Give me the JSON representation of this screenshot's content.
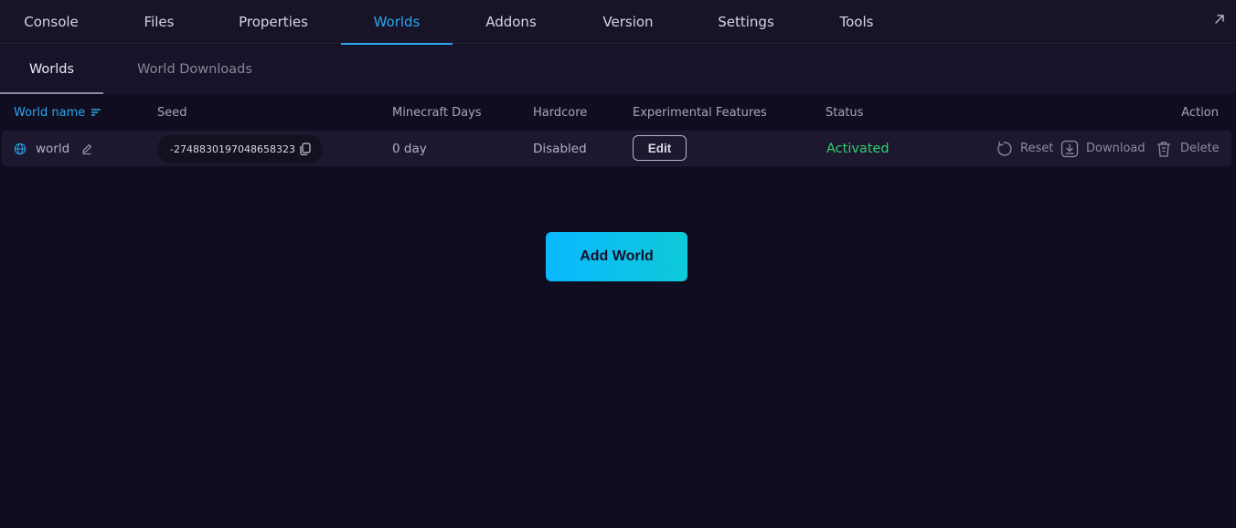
{
  "topnav": {
    "tabs": [
      {
        "label": "Console"
      },
      {
        "label": "Files"
      },
      {
        "label": "Properties"
      },
      {
        "label": "Worlds"
      },
      {
        "label": "Addons"
      },
      {
        "label": "Version"
      },
      {
        "label": "Settings"
      },
      {
        "label": "Tools"
      }
    ],
    "active_tab": "Worlds",
    "external_icon": "external-link-icon"
  },
  "subnav": {
    "tabs": [
      {
        "label": "Worlds"
      },
      {
        "label": "World Downloads"
      }
    ],
    "active_tab": "Worlds"
  },
  "table": {
    "headers": {
      "world_name": "World name",
      "seed": "Seed",
      "minecraft_days": "Minecraft Days",
      "hardcore": "Hardcore",
      "experimental": "Experimental Features",
      "status": "Status",
      "action": "Action"
    },
    "sorted_column": "World name",
    "rows": [
      {
        "world_name": "world",
        "seed": "-2748830197048658323",
        "minecraft_days": "0 day",
        "hardcore": "Disabled",
        "experimental_button": "Edit",
        "status": "Activated",
        "actions": {
          "reset": "Reset",
          "download": "Download",
          "delete": "Delete"
        }
      }
    ]
  },
  "add_world_label": "Add World",
  "colors": {
    "background": "#110d20",
    "accent": "#27a7ee",
    "status_active": "#2fd46d",
    "button_gradient_start": "#0ab8ff",
    "button_gradient_end": "#0dcad8"
  }
}
